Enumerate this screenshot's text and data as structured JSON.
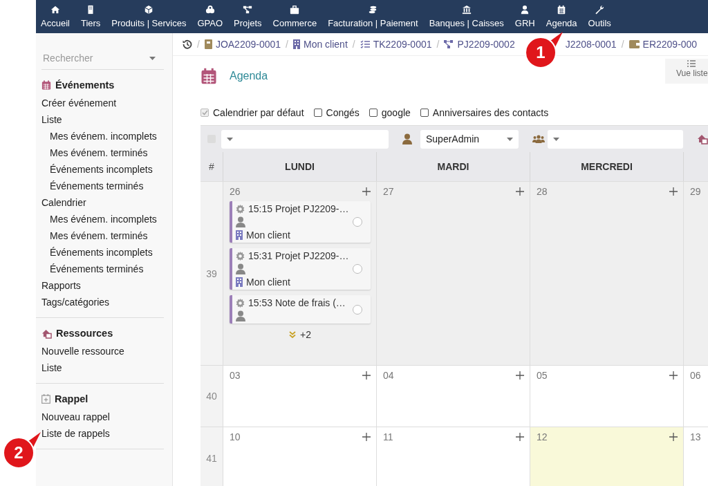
{
  "top_menu": [
    {
      "label": "Accueil"
    },
    {
      "label": "Tiers"
    },
    {
      "label": "Produits | Services"
    },
    {
      "label": "GPAO"
    },
    {
      "label": "Projets"
    },
    {
      "label": "Commerce"
    },
    {
      "label": "Facturation | Paiement"
    },
    {
      "label": "Banques | Caisses"
    },
    {
      "label": "GRH"
    },
    {
      "label": "Agenda"
    },
    {
      "label": "Outils"
    }
  ],
  "sidebar": {
    "search": {
      "placeholder": "Rechercher"
    },
    "sections": [
      {
        "title": "Événements",
        "items": [
          {
            "label": "Créer événement"
          },
          {
            "label": "Liste",
            "children": [
              {
                "label": "Mes événem. incomplets"
              },
              {
                "label": "Mes événem. terminés"
              },
              {
                "label": "Événements incomplets"
              },
              {
                "label": "Événements terminés"
              }
            ]
          },
          {
            "label": "Calendrier",
            "children": [
              {
                "label": "Mes événem. incomplets"
              },
              {
                "label": "Mes événem. terminés"
              },
              {
                "label": "Événements incomplets"
              },
              {
                "label": "Événements terminés"
              }
            ]
          },
          {
            "label": "Rapports"
          },
          {
            "label": "Tags/catégories"
          }
        ]
      },
      {
        "title": "Ressources",
        "items": [
          {
            "label": "Nouvelle ressource"
          },
          {
            "label": "Liste"
          }
        ]
      },
      {
        "title": "Rappel",
        "items": [
          {
            "label": "Nouveau rappel"
          },
          {
            "label": "Liste de rappels"
          }
        ]
      }
    ]
  },
  "breadcrumbs": [
    {
      "separator": "/",
      "label": "JOA2209-0001"
    },
    {
      "separator": "/",
      "label": "Mon client"
    },
    {
      "separator": "/",
      "label": "TK2209-0001"
    },
    {
      "separator": "/",
      "label": "PJ2209-0002"
    },
    {
      "label": "J2208-0001"
    },
    {
      "separator": "/",
      "label": "ER2209-000"
    }
  ],
  "page": {
    "title": "Agenda",
    "view_button": "Vue liste"
  },
  "calendars": [
    {
      "label": "Calendrier par défaut",
      "checked": true,
      "disabled": true
    },
    {
      "label": "Congés",
      "checked": false,
      "disabled": false
    },
    {
      "label": "google",
      "checked": false,
      "disabled": false
    },
    {
      "label": "Anniversaires des contacts",
      "checked": false,
      "disabled": false
    }
  ],
  "filters": {
    "select_all": {
      "checked": false,
      "disabled": true
    },
    "user": "SuperAdmin"
  },
  "calendar": {
    "week_header": "#",
    "days": [
      "LUNDI",
      "MARDI",
      "MERCREDI"
    ],
    "weeks": [
      {
        "number": "39",
        "cells": [
          {
            "day": "26",
            "past": true,
            "today": false,
            "events": [
              {
                "title": "15:15 Projet PJ2209-…",
                "company": "Mon client"
              },
              {
                "title": "15:31 Projet PJ2209-…",
                "company": "Mon client"
              },
              {
                "title": "15:53 Note de frais (…"
              }
            ],
            "more": "+2"
          },
          {
            "day": "27",
            "past": true,
            "today": false
          },
          {
            "day": "28",
            "past": true,
            "today": false
          },
          {
            "day": "29",
            "past": true,
            "today": false
          }
        ]
      },
      {
        "number": "40",
        "cells": [
          {
            "day": "03",
            "past": false,
            "today": false
          },
          {
            "day": "04",
            "past": false,
            "today": false
          },
          {
            "day": "05",
            "past": false,
            "today": false
          },
          {
            "day": "06",
            "past": false,
            "today": false
          }
        ]
      },
      {
        "number": "41",
        "cells": [
          {
            "day": "10",
            "past": false,
            "today": false
          },
          {
            "day": "11",
            "past": false,
            "today": false
          },
          {
            "day": "12",
            "past": false,
            "today": true
          },
          {
            "day": "13",
            "past": false,
            "today": false
          }
        ]
      }
    ]
  },
  "callouts": [
    {
      "number": "1"
    },
    {
      "number": "2"
    }
  ]
}
